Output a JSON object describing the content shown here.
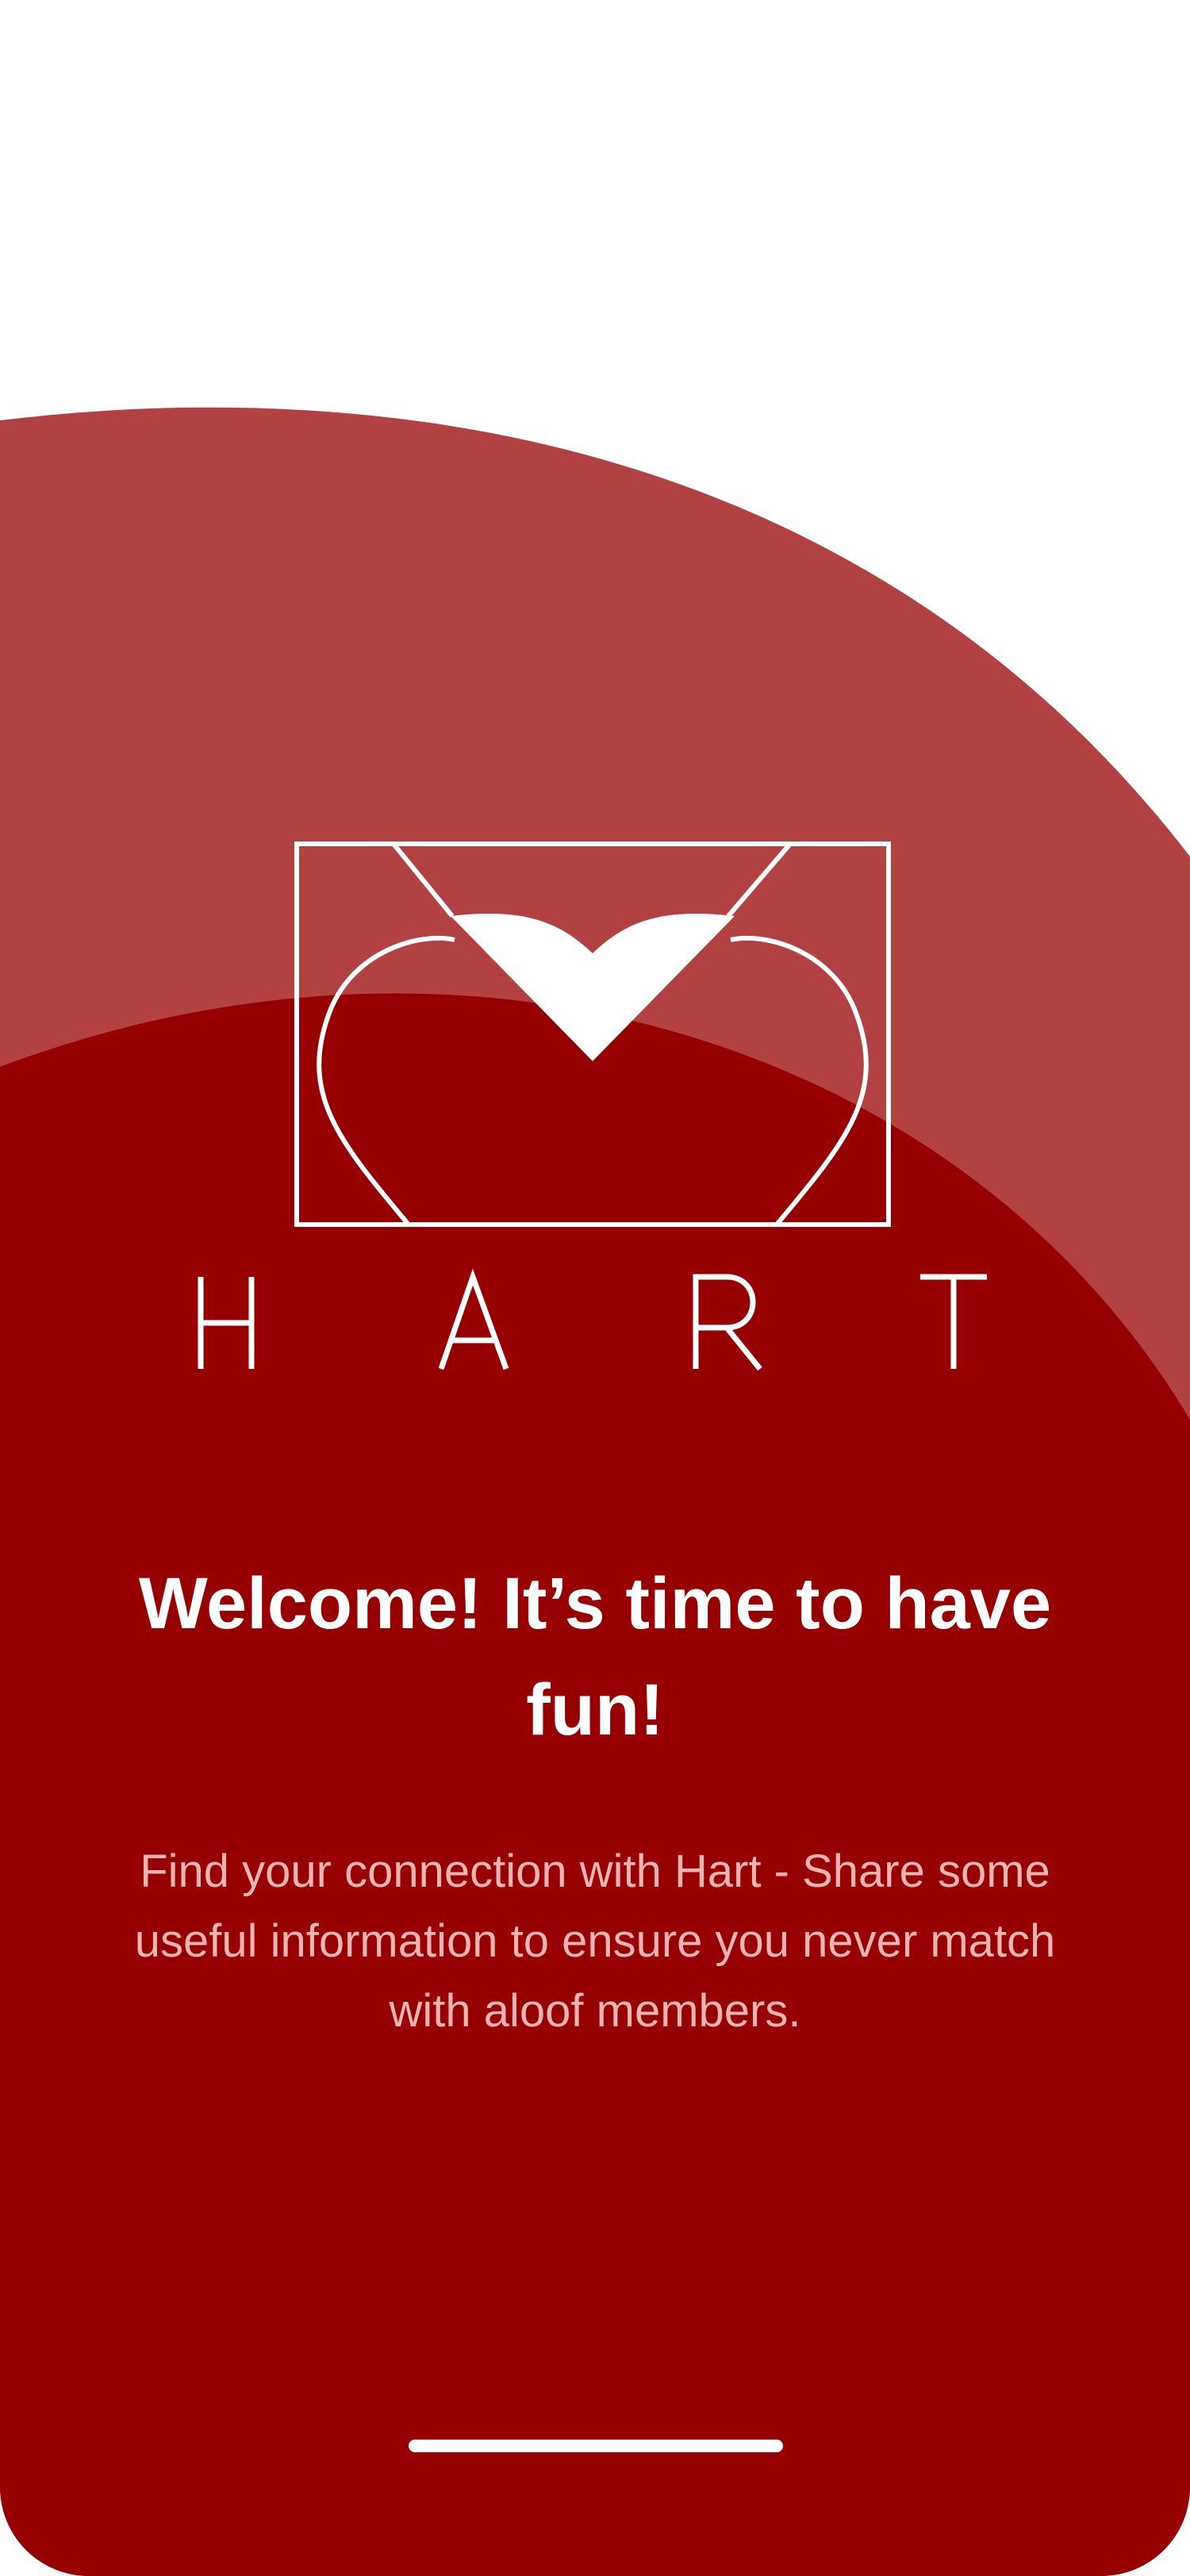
{
  "app": {
    "brand_name": "HART",
    "logo_icon": "heart-envelope-icon"
  },
  "colors": {
    "background": "#ffffff",
    "upper_arc": "#b24242",
    "lower_arc": "#960000",
    "text_primary": "#ffffff",
    "text_secondary": "#efb3b3"
  },
  "onboarding": {
    "headline": "Welcome! It’s time to have fun!",
    "description": "Find your connection with Hart - Share some useful information to ensure you never match with aloof members."
  }
}
